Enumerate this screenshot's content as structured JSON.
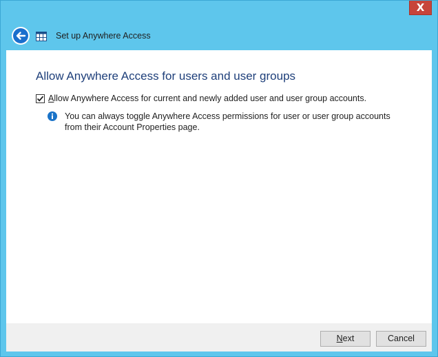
{
  "window": {
    "close_glyph": "X"
  },
  "nav": {
    "title": "Set up Anywhere Access",
    "back_icon": "back-arrow-icon",
    "app_icon": "grid-window-icon"
  },
  "content": {
    "heading": "Allow Anywhere Access for users and user groups",
    "checkbox": {
      "checked": true,
      "label": "Allow Anywhere Access for current and newly added user and user group accounts.",
      "accesskey": "A"
    },
    "info": {
      "icon": "info-icon",
      "text": "You can always toggle Anywhere Access permissions for user or user group accounts from their Account Properties page."
    }
  },
  "footer": {
    "next": {
      "accesskey": "N",
      "rest": "ext"
    },
    "cancel_label": "Cancel"
  },
  "colors": {
    "frame": "#5ec6ec",
    "heading": "#1e3f7a",
    "back_button": "#1a6fcd",
    "info": "#1a73c8",
    "close": "#c7453b"
  }
}
